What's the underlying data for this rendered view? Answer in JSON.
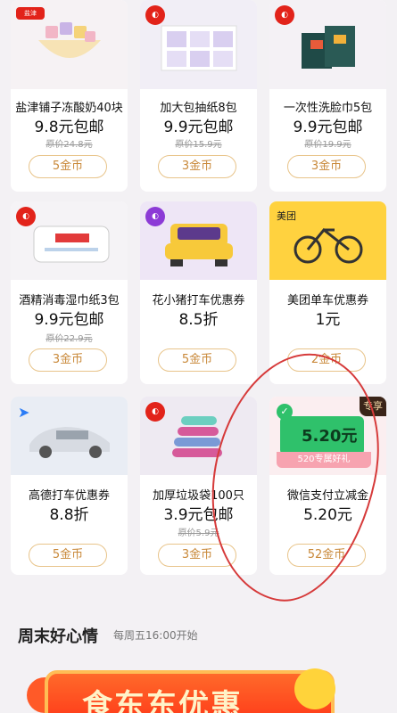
{
  "row1": [
    {
      "name": "盐津铺子冻酸奶40块",
      "price": "9.8元包邮",
      "orig": "原价24.8元",
      "coin": "5金币"
    },
    {
      "name": "加大包抽纸8包",
      "price": "9.9元包邮",
      "orig": "原价15.9元",
      "coin": "3金币"
    },
    {
      "name": "一次性洗脸巾5包",
      "price": "9.9元包邮",
      "orig": "原价19.9元",
      "coin": "3金币"
    }
  ],
  "row2": [
    {
      "name": "酒精消毒湿巾纸3包",
      "price": "9.9元包邮",
      "orig": "原价22.9元",
      "coin": "3金币"
    },
    {
      "name": "花小猪打车优惠券",
      "price": "8.5折",
      "orig": "",
      "coin": "5金币"
    },
    {
      "name": "美团单车优惠券",
      "price": "1元",
      "orig": "",
      "coin": "2金币",
      "brand": "美团"
    }
  ],
  "row3": [
    {
      "name": "高德打车优惠券",
      "price": "8.8折",
      "orig": "",
      "coin": "5金币"
    },
    {
      "name": "加厚垃圾袋100只",
      "price": "3.9元包邮",
      "orig": "原价5.9元",
      "coin": "3金币"
    },
    {
      "name": "微信支付立减金",
      "price": "5.20元",
      "orig": "",
      "coin": "52金币",
      "tag": "专享",
      "card_amount": "5.20元",
      "card_foot": "520专属好礼"
    }
  ],
  "section": {
    "title": "周末好心情",
    "subtitle": "每周五16:00开始"
  },
  "banner": {
    "text": "食东东优惠"
  },
  "colors": {
    "accent": "#c9893a",
    "background": "#f3f1f4",
    "annotation": "#d63a3a"
  }
}
